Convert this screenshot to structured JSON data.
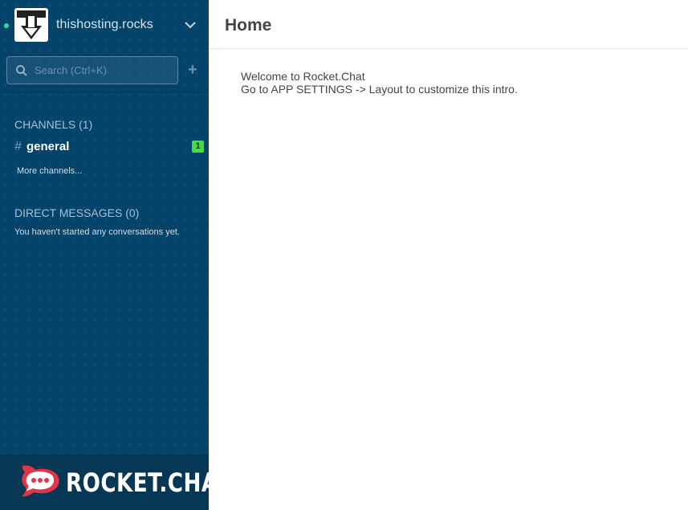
{
  "sidebar": {
    "account": {
      "server_name": "thishosting.rocks",
      "status_color": "#2de0a5"
    },
    "search": {
      "placeholder": "Search (Ctrl+K)",
      "add_label": "+"
    },
    "channels": {
      "title": "CHANNELS (1)",
      "items": [
        {
          "prefix": "#",
          "name": "general",
          "unread": "1"
        }
      ],
      "more_label": "More channels..."
    },
    "direct_messages": {
      "title": "DIRECT MESSAGES (0)",
      "empty_text": "You haven't started any conversations yet."
    },
    "footer": {
      "logo_text": "ROCKET.CHAT",
      "logo_color": "#e0364b"
    }
  },
  "main": {
    "title": "Home",
    "intro_line1": "Welcome to Rocket.Chat",
    "intro_line2": "Go to APP SETTINGS -> Layout to customize this intro."
  },
  "colors": {
    "sidebar_bg": "#04436a",
    "unread_badge": "#3fe03f"
  }
}
